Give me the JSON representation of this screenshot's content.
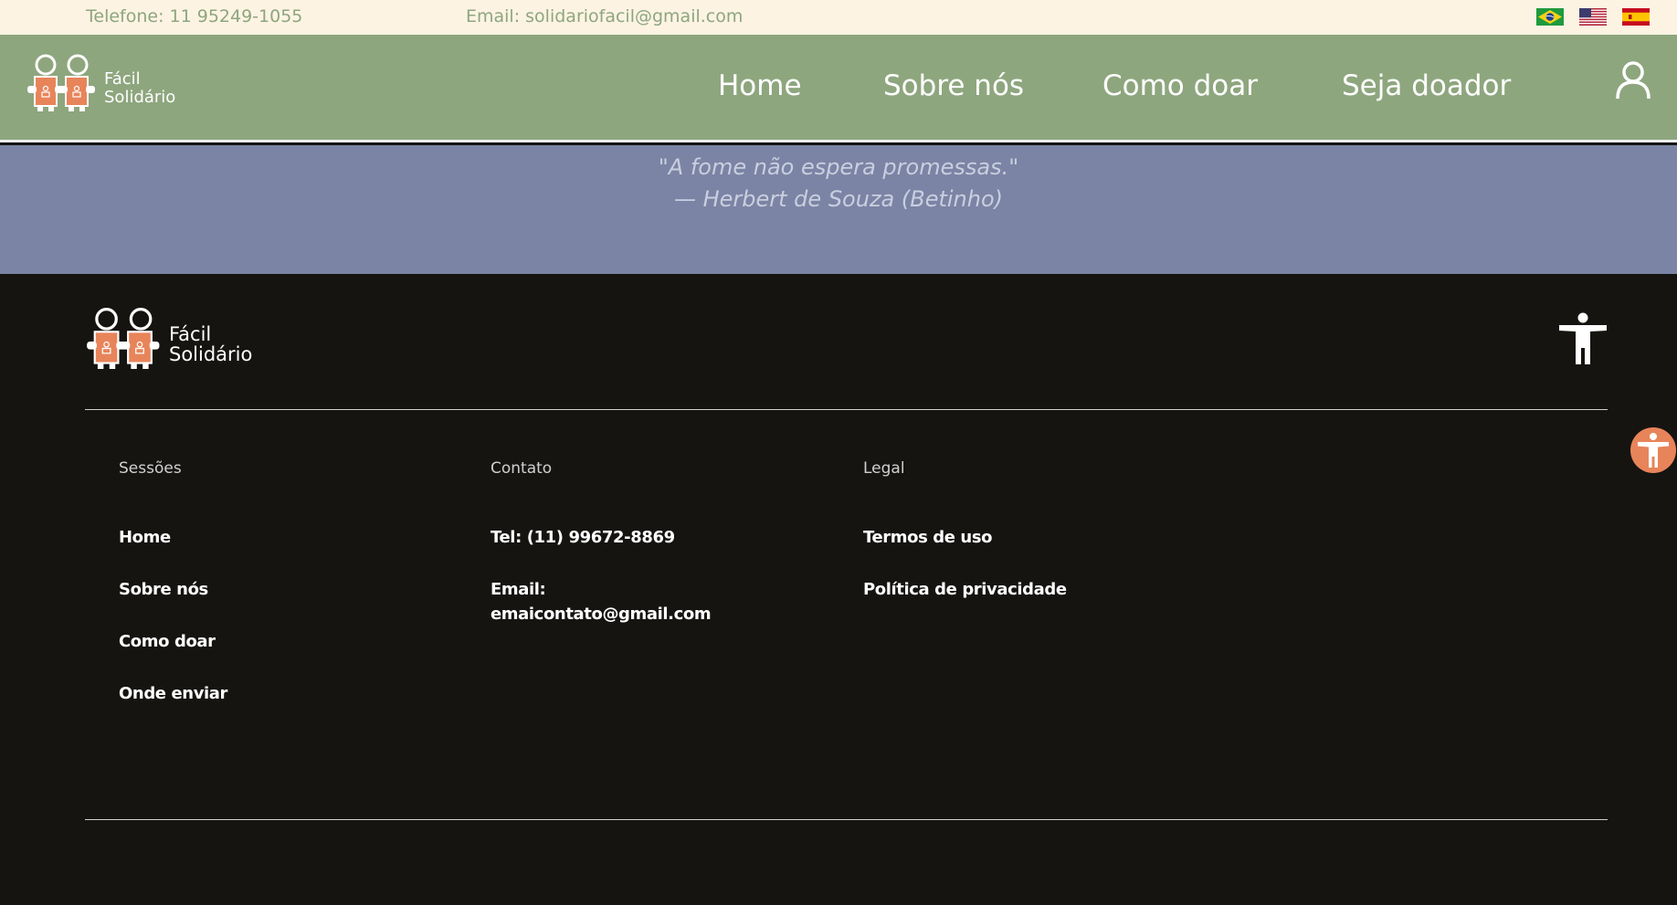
{
  "topbar": {
    "phone": "Telefone: 11 95249-1055",
    "email": "Email: solidariofacil@gmail.com",
    "flags": [
      "brazil-flag",
      "usa-flag",
      "spain-flag"
    ]
  },
  "brand": {
    "line1": "Fácil",
    "line2": "Solidário"
  },
  "nav": {
    "items": [
      {
        "label": "Home"
      },
      {
        "label": "Sobre nós"
      },
      {
        "label": "Como doar"
      },
      {
        "label": "Seja doador"
      }
    ],
    "user_icon": "user-icon"
  },
  "quote": {
    "text": "\"A fome não espera promessas.\"",
    "author": "— Herbert de Souza (Betinho)"
  },
  "footer": {
    "sessions": {
      "heading": "Sessões",
      "links": [
        "Home",
        "Sobre nós",
        "Como doar",
        "Onde enviar"
      ]
    },
    "contact": {
      "heading": "Contato",
      "phone": "Tel: (11) 99672-8869",
      "email_label": "Email:",
      "email_value": "emaicontato@gmail.com"
    },
    "legal": {
      "heading": "Legal",
      "links": [
        "Termos de uso",
        "Política de privacidade"
      ]
    }
  },
  "colors": {
    "topbar_bg": "#fdf3e3",
    "nav_bg": "#8ea67e",
    "quote_bg": "#7b84a4",
    "footer_bg": "#151411",
    "accent_orange": "#e8845a"
  }
}
